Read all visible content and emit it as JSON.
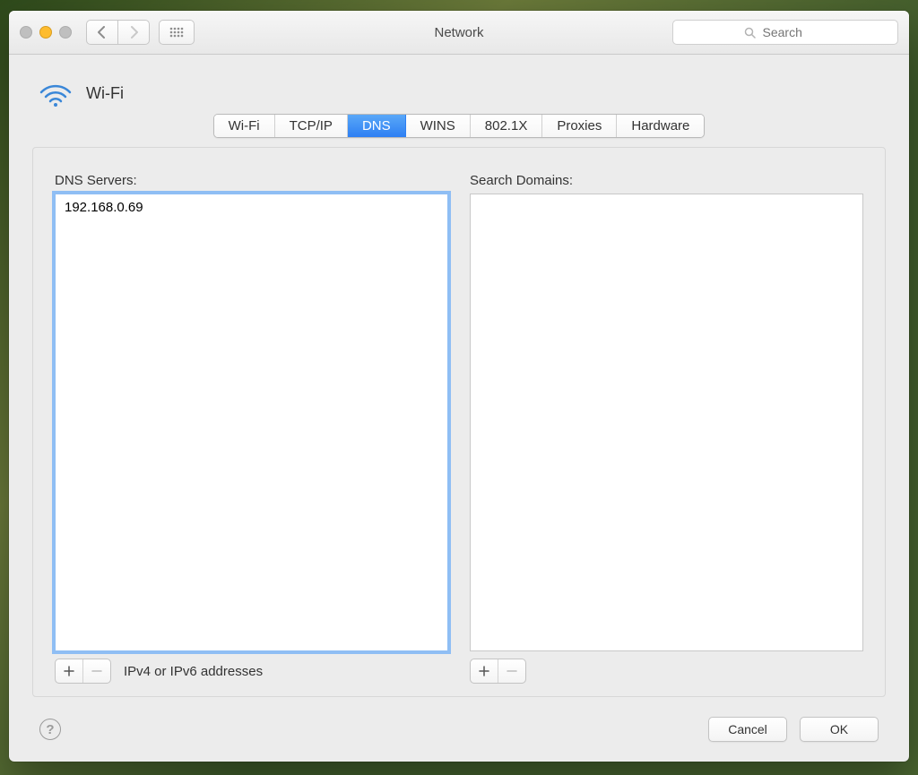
{
  "window": {
    "title": "Network",
    "search_placeholder": "Search"
  },
  "header": {
    "connection_name": "Wi-Fi"
  },
  "tabs": [
    {
      "id": "wifi",
      "label": "Wi-Fi",
      "active": false
    },
    {
      "id": "tcpip",
      "label": "TCP/IP",
      "active": false
    },
    {
      "id": "dns",
      "label": "DNS",
      "active": true
    },
    {
      "id": "wins",
      "label": "WINS",
      "active": false
    },
    {
      "id": "8021x",
      "label": "802.1X",
      "active": false
    },
    {
      "id": "proxies",
      "label": "Proxies",
      "active": false
    },
    {
      "id": "hardware",
      "label": "Hardware",
      "active": false
    }
  ],
  "dns": {
    "servers_label": "DNS Servers:",
    "servers": [
      "192.168.0.69"
    ],
    "hint": "IPv4 or IPv6 addresses",
    "domains_label": "Search Domains:",
    "domains": []
  },
  "buttons": {
    "cancel": "Cancel",
    "ok": "OK"
  }
}
